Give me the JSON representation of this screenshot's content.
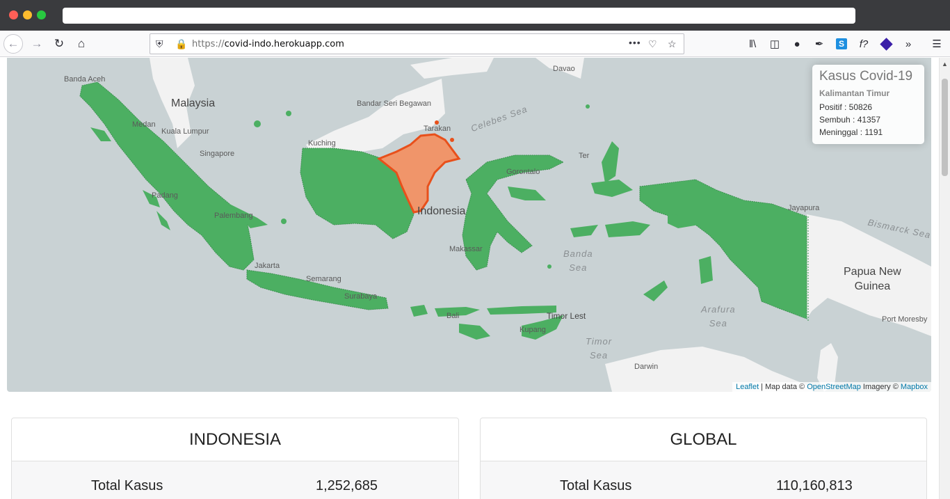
{
  "browser": {
    "url_protocol": "https://",
    "url_host": "covid-indo.herokuapp.com",
    "icons": [
      "back-icon",
      "forward-icon",
      "reload-icon",
      "home-icon",
      "shield-icon",
      "lock-icon",
      "more-icon",
      "pocket-icon",
      "bookmark-star-icon",
      "library-icon",
      "sidebar-icon",
      "account-icon",
      "eyedropper-icon",
      "skype-icon",
      "fx-icon",
      "extension-icon",
      "overflow-icon",
      "menu-icon"
    ]
  },
  "map": {
    "labels": {
      "banda_aceh": "Banda Aceh",
      "malaysia": "Malaysia",
      "medan": "Medan",
      "kuala_lumpur": "Kuala Lumpur",
      "singapore": "Singapore",
      "padang": "Padang",
      "palembang": "Palembang",
      "jakarta": "Jakarta",
      "semarang": "Semarang",
      "surabaya": "Surabaya",
      "bandar_seri_begawan": "Bandar Seri Begawan",
      "kuching": "Kuching",
      "tarakan": "Tarakan",
      "celebes_sea": "Celebes Sea",
      "davao": "Davao",
      "gorontalo": "Gorontalo",
      "indonesia": "Indonesia",
      "makassar": "Makassar",
      "banda_sea": "Banda\nSea",
      "timor_leste": "Timor Lest",
      "kupang": "Kupang",
      "timor_sea": "Timor\nSea",
      "darwin": "Darwin",
      "arafura_sea": "Arafura\nSea",
      "jayapura": "Jayapura",
      "bismarck_sea": "Bismarck Sea",
      "papua_new_guinea": "Papua New\nGuinea",
      "port_moresby": "Port Moresby",
      "ternate": "Ter",
      "bali": "Bali"
    },
    "colors": {
      "province_fill": "#4caf62",
      "highlight_fill": "#f0956a",
      "highlight_border": "#e8501b",
      "water": "#c9d2d4",
      "land": "#f2f2f2"
    },
    "info": {
      "title": "Kasus Covid-19",
      "region": "Kalimantan Timur",
      "positif": "Positif : 50826",
      "sembuh": "Sembuh : 41357",
      "meninggal": "Meninggal : 1191"
    },
    "attribution": {
      "leaflet": "Leaflet",
      "sep1": " | Map data © ",
      "osm": "OpenStreetMap",
      "sep2": " Imagery © ",
      "mapbox": "Mapbox"
    }
  },
  "cards": {
    "indonesia": {
      "title": "INDONESIA",
      "label": "Total Kasus",
      "value": "1,252,685"
    },
    "global": {
      "title": "GLOBAL",
      "label": "Total Kasus",
      "value": "110,160,813"
    }
  }
}
